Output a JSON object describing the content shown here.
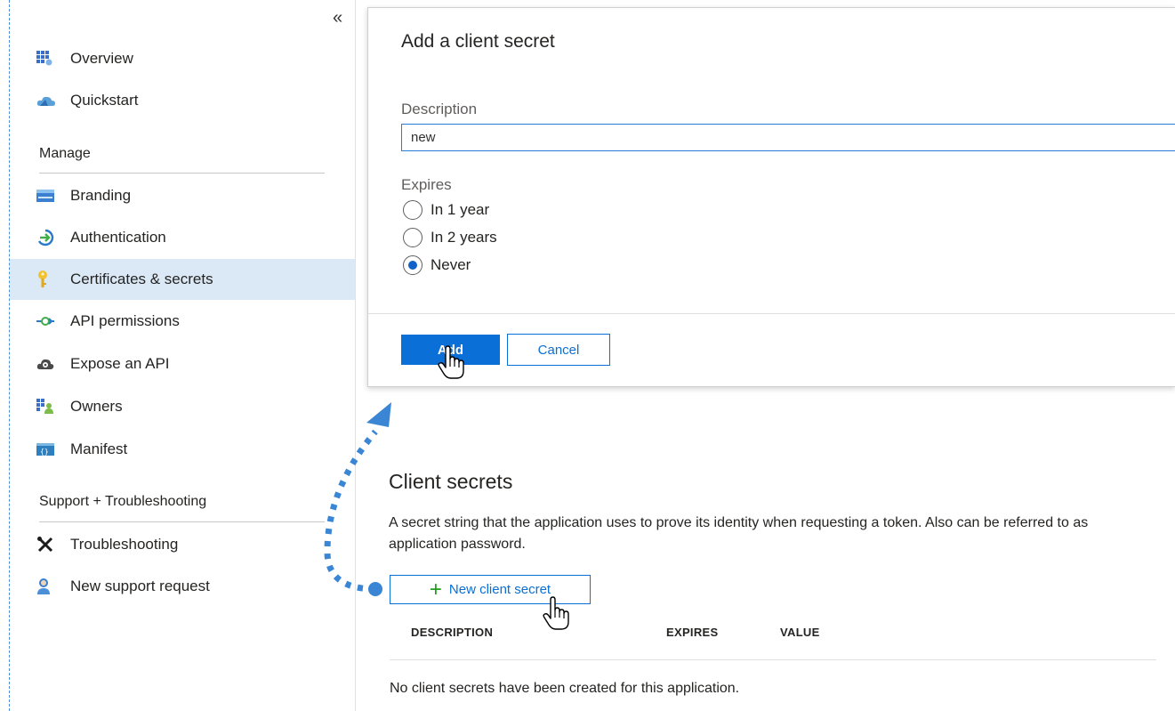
{
  "sidebar": {
    "collapse_glyph": "«",
    "items_top": [
      {
        "label": "Overview",
        "icon": "overview-grid-icon"
      },
      {
        "label": "Quickstart",
        "icon": "quickstart-cloud-icon"
      }
    ],
    "section_manage": "Manage",
    "items_manage": [
      {
        "label": "Branding",
        "icon": "branding-icon"
      },
      {
        "label": "Authentication",
        "icon": "authentication-arrow-icon"
      },
      {
        "label": "Certificates & secrets",
        "icon": "key-icon",
        "active": true
      },
      {
        "label": "API permissions",
        "icon": "api-permissions-icon"
      },
      {
        "label": "Expose an API",
        "icon": "cloud-gear-icon"
      },
      {
        "label": "Owners",
        "icon": "owners-icon"
      },
      {
        "label": "Manifest",
        "icon": "manifest-icon"
      }
    ],
    "section_support": "Support + Troubleshooting",
    "items_support": [
      {
        "label": "Troubleshooting",
        "icon": "tools-icon"
      },
      {
        "label": "New support request",
        "icon": "support-person-icon"
      }
    ]
  },
  "dialog": {
    "title": "Add a client secret",
    "description_label": "Description",
    "description_value": "new",
    "expires_label": "Expires",
    "options": [
      "In 1 year",
      "In 2 years",
      "Never"
    ],
    "selected": "Never",
    "add_label": "Add",
    "cancel_label": "Cancel"
  },
  "client_secrets": {
    "title": "Client secrets",
    "description": "A secret string that the application uses to prove its identity when requesting a token. Also can be referred to as application password.",
    "new_button_label": "New client secret",
    "columns": [
      "DESCRIPTION",
      "EXPIRES",
      "VALUE"
    ],
    "empty_message": "No client secrets have been created for this application."
  },
  "colors": {
    "accent": "#0a6fd6",
    "active_bg": "#dbe9f7",
    "annotation_arrow": "#3a86d4",
    "plus_green": "#1f9d1f"
  }
}
